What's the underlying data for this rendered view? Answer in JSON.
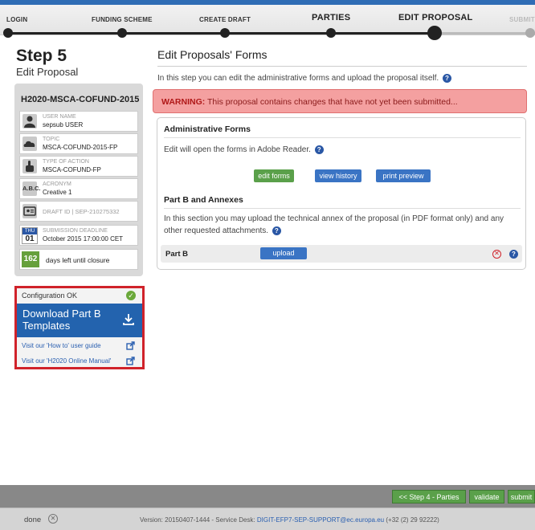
{
  "steps": [
    {
      "label": "LOGIN"
    },
    {
      "label": "FUNDING SCHEME"
    },
    {
      "label": "CREATE DRAFT"
    },
    {
      "label": "PARTIES"
    },
    {
      "label": "EDIT PROPOSAL"
    },
    {
      "label": "SUBMIT"
    }
  ],
  "sidebar": {
    "step_title": "Step 5",
    "step_subtitle": "Edit Proposal",
    "proposal_code": "H2020-MSCA-COFUND-2015",
    "username_label": "USER NAME",
    "username_value": "sepsub USER",
    "topic_label": "TOPIC",
    "topic_value": "MSCA-COFUND-2015-FP",
    "action_label": "TYPE OF ACTION",
    "action_value": "MSCA-COFUND-FP",
    "acronym_label": "ACRONYM",
    "acronym_value": "Creative 1",
    "draft_id": "DRAFT ID | SEP-210275332",
    "deadline_label": "SUBMISSION DEADLINE",
    "deadline_value": "October 2015 17:00:00 CET",
    "deadline_dow": "THU",
    "deadline_day": "01",
    "days_left": "162",
    "days_left_text": "days left until closure",
    "abc_icon": "A.B.C."
  },
  "config": {
    "status": "Configuration OK",
    "download_label": "Download Part B Templates",
    "guide_link": "Visit our 'How to' user guide",
    "manual_link": "Visit our 'H2020 Online Manual'"
  },
  "main": {
    "title": "Edit Proposals' Forms",
    "intro": "In this step you can edit the administrative forms and upload the proposal itself.",
    "warning_label": "WARNING:",
    "warning_text": "This proposal contains changes that have not yet been submitted...",
    "admin_head": "Administrative Forms",
    "admin_text": "Edit will open the forms in Adobe Reader.",
    "btn_edit": "edit forms",
    "btn_history": "view history",
    "btn_preview": "print preview",
    "partb_head": "Part B and Annexes",
    "partb_text": "In this section you may upload the technical annex of the proposal (in PDF format only) and any other requested attachments.",
    "partb_label": "Part B",
    "upload_label": "upload"
  },
  "nav": {
    "back": "<< Step 4 - Parties",
    "validate": "validate",
    "submit": "submit"
  },
  "status_bar": {
    "done": "done",
    "version": "Version: 20150407-1444 - Service Desk:",
    "email": "DIGIT-EFP7-SEP-SUPPORT@ec.europa.eu",
    "phone": "(+32 (2) 29 92222)"
  },
  "colors": {
    "accent": "#2363ae",
    "warning_bg": "#f4a0a0",
    "highlight_border": "#d0222a",
    "green_button": "#5aa04a"
  }
}
